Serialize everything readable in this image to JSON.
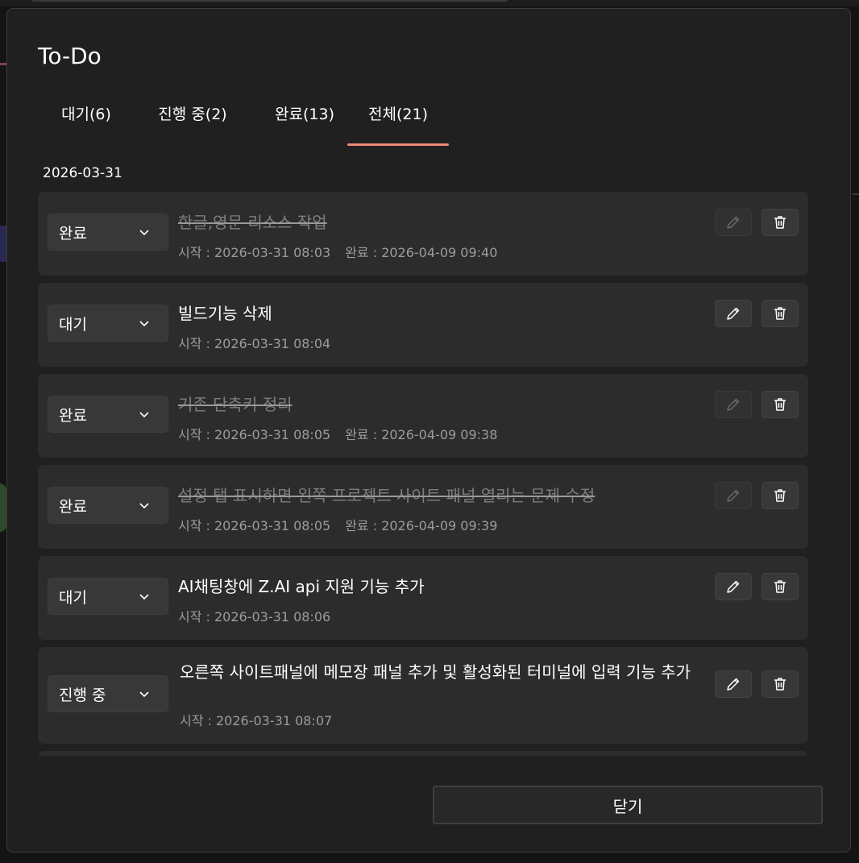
{
  "dialog": {
    "title": "To-Do",
    "tabs": [
      {
        "label": "대기(6)",
        "active": false
      },
      {
        "label": "진행 중(2)",
        "active": false
      },
      {
        "label": "완료(13)",
        "active": false
      },
      {
        "label": "전체(21)",
        "active": true
      }
    ],
    "accent_color": "#f08a79",
    "date_group": "2026-03-31",
    "tasks": [
      {
        "status": "완료",
        "title": "한글,영문 리소스 작업",
        "start": "시작 : 2026-03-31 08:03",
        "done": "완료 : 2026-04-09 09:40",
        "completed": true
      },
      {
        "status": "대기",
        "title": "빌드기능 삭제",
        "start": "시작 : 2026-03-31 08:04",
        "done": "",
        "completed": false
      },
      {
        "status": "완료",
        "title": "기존 단축키 정리",
        "start": "시작 : 2026-03-31 08:05",
        "done": "완료 : 2026-04-09 09:38",
        "completed": true
      },
      {
        "status": "완료",
        "title": "설정 탭 표시하면 왼쪽 프로젝트 사이트 패널 열리는 문제 수정",
        "start": "시작 : 2026-03-31 08:05",
        "done": "완료 : 2026-04-09 09:39",
        "completed": true
      },
      {
        "status": "대기",
        "title": "AI채팅창에 Z.AI api 지원 기능 추가",
        "start": "시작 : 2026-03-31 08:06",
        "done": "",
        "completed": false
      },
      {
        "status": "진행 중",
        "title": "오른쪽 사이트패널에 메모장 패널 추가 및 활성화된 터미널에 입력 기능 추가",
        "start": "시작 : 2026-03-31 08:07",
        "done": "",
        "completed": false
      }
    ],
    "icons": {
      "dropdown": "chevron-down-icon",
      "edit": "pencil-icon",
      "delete": "trash-icon"
    },
    "close_label": "닫기"
  }
}
